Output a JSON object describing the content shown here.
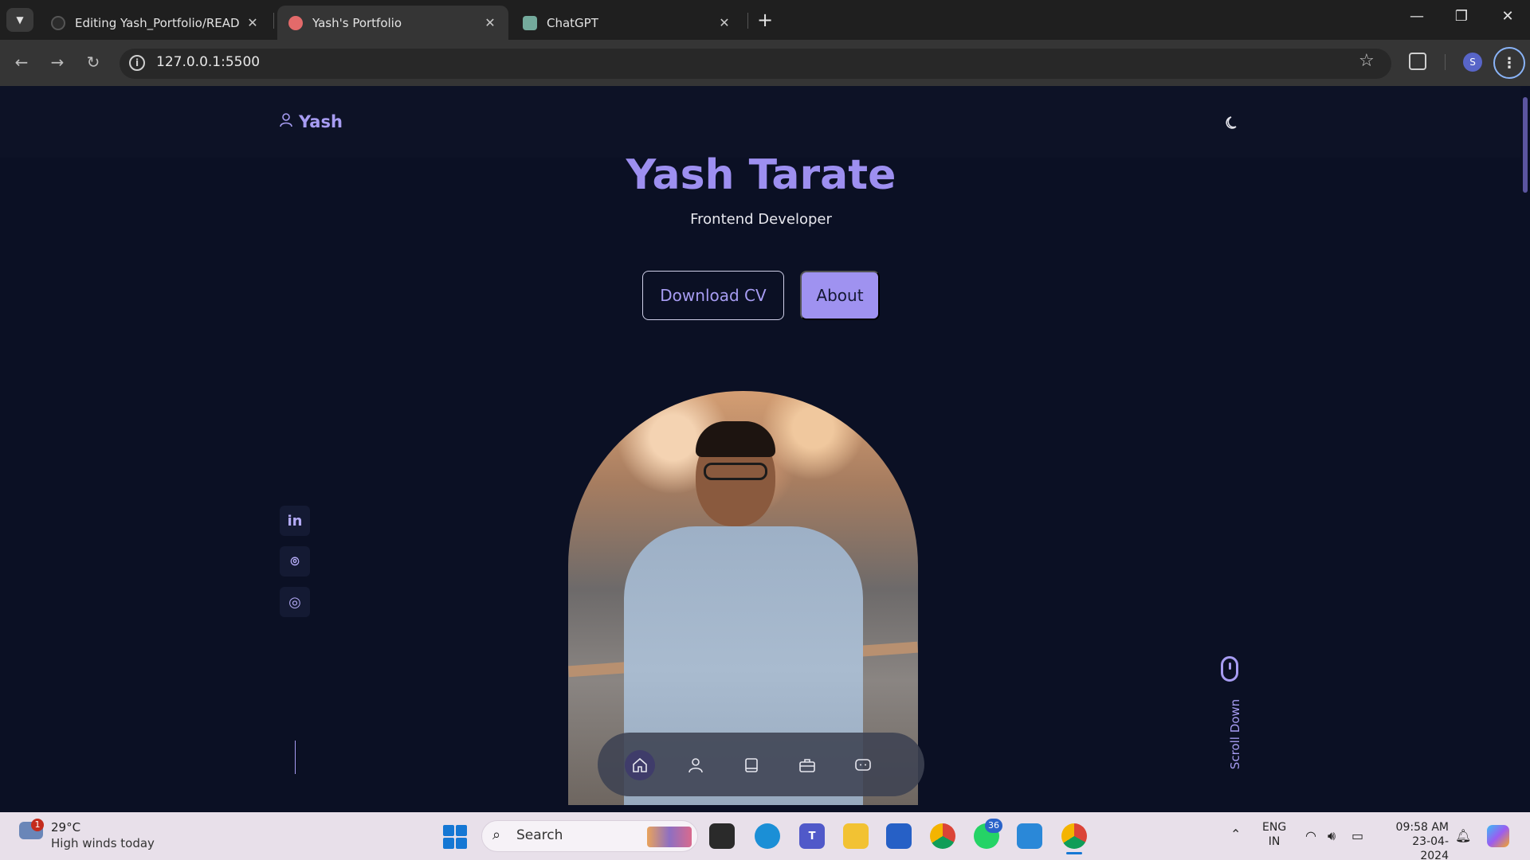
{
  "browser": {
    "tabs": [
      {
        "title": "Editing Yash_Portfolio/READM",
        "active": false
      },
      {
        "title": "Yash's Portfolio",
        "active": true
      },
      {
        "title": "ChatGPT",
        "active": false
      }
    ],
    "url": "127.0.0.1:5500",
    "profile_initial": "S"
  },
  "site": {
    "logo": "Yash",
    "name": "Yash Tarate",
    "role": "Frontend Developer",
    "buttons": {
      "download_cv": "Download CV",
      "about": "About"
    },
    "social": [
      {
        "name": "linkedin",
        "glyph": "in"
      },
      {
        "name": "github",
        "glyph": "⌾"
      },
      {
        "name": "instagram",
        "glyph": "◎"
      }
    ],
    "scroll_label": "Scroll Down",
    "bottom_nav": [
      "home",
      "about",
      "resume",
      "portfolio",
      "contact"
    ],
    "accent": "#a79cf2",
    "background": "#0b1024"
  },
  "taskbar": {
    "weather_temp": "29°C",
    "weather_desc": "High winds today",
    "weather_alert_count": "1",
    "search_placeholder": "Search",
    "whatsapp_badge": "36",
    "lang_line1": "ENG",
    "lang_line2": "IN",
    "time": "09:58 AM",
    "date": "23-04-2024"
  }
}
